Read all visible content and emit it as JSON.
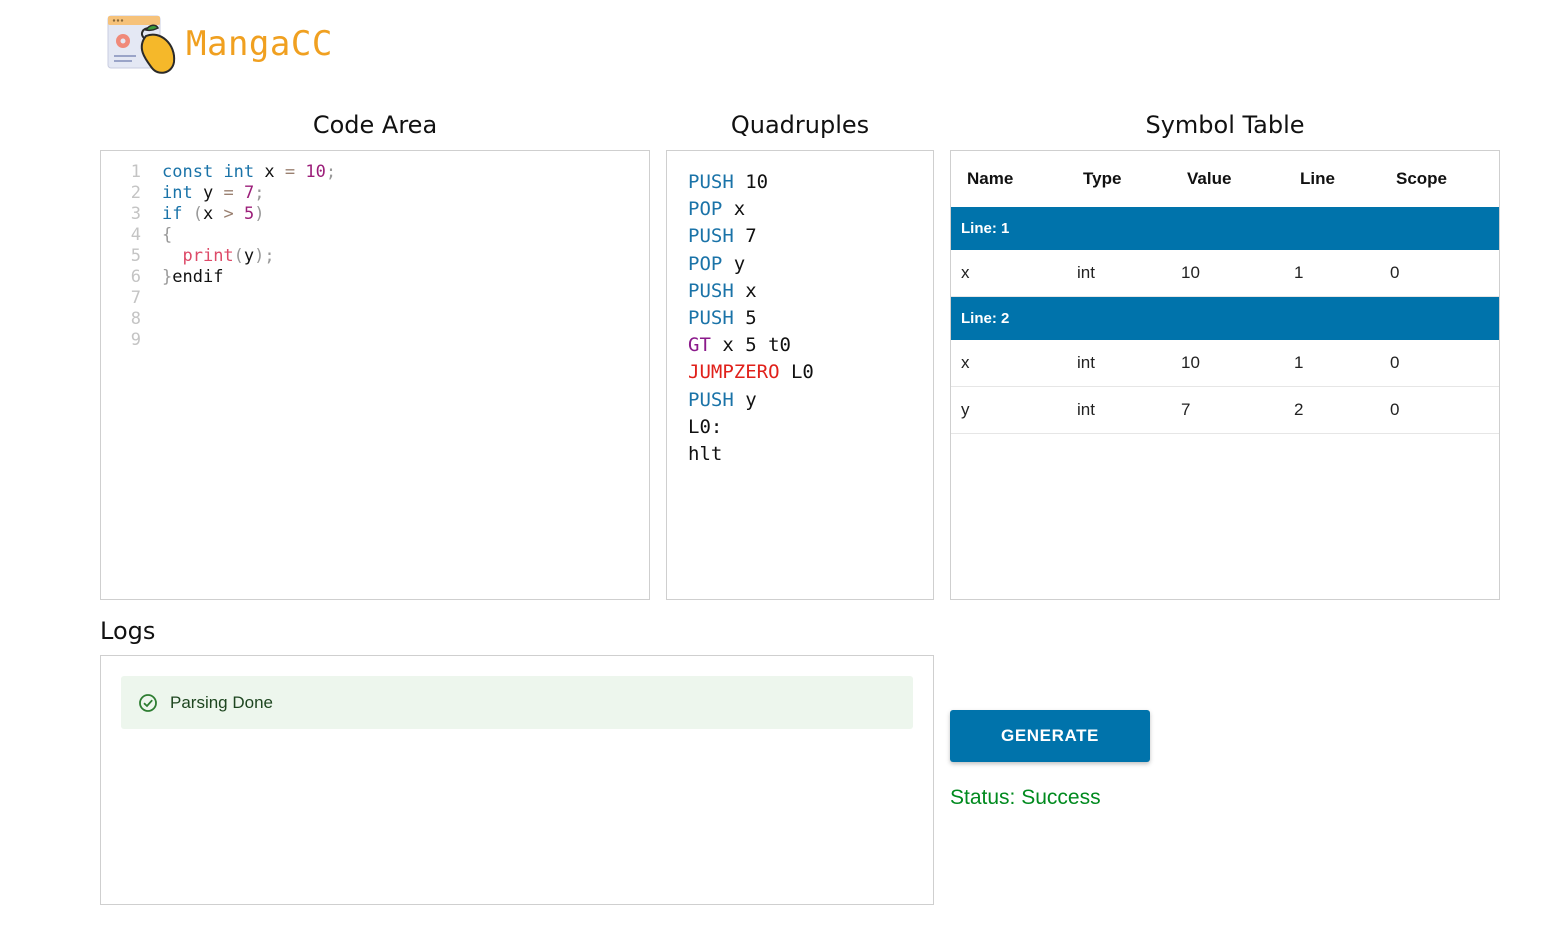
{
  "header": {
    "brand": "MangaCC",
    "logo_icon": "mango-window-icon"
  },
  "titles": {
    "code_area": "Code Area",
    "quadruples": "Quadruples",
    "symbol_table": "Symbol Table",
    "logs": "Logs"
  },
  "code": {
    "line_numbers": [
      "1",
      "2",
      "3",
      "4",
      "5",
      "6",
      "7",
      "8",
      "9"
    ],
    "lines": [
      [
        {
          "t": "const",
          "c": "kw"
        },
        {
          "t": " ",
          "c": "txt"
        },
        {
          "t": "int",
          "c": "kw"
        },
        {
          "t": " x ",
          "c": "txt"
        },
        {
          "t": "=",
          "c": "op"
        },
        {
          "t": " ",
          "c": "txt"
        },
        {
          "t": "10",
          "c": "num"
        },
        {
          "t": ";",
          "c": "punc"
        }
      ],
      [
        {
          "t": "int",
          "c": "kw"
        },
        {
          "t": " y ",
          "c": "txt"
        },
        {
          "t": "=",
          "c": "op"
        },
        {
          "t": " ",
          "c": "txt"
        },
        {
          "t": "7",
          "c": "num"
        },
        {
          "t": ";",
          "c": "punc"
        }
      ],
      [
        {
          "t": "if",
          "c": "kw"
        },
        {
          "t": " ",
          "c": "txt"
        },
        {
          "t": "(",
          "c": "punc"
        },
        {
          "t": "x ",
          "c": "txt"
        },
        {
          "t": ">",
          "c": "op"
        },
        {
          "t": " ",
          "c": "txt"
        },
        {
          "t": "5",
          "c": "num"
        },
        {
          "t": ")",
          "c": "punc"
        }
      ],
      [
        {
          "t": "{",
          "c": "punc"
        }
      ],
      [
        {
          "t": "  ",
          "c": "txt"
        },
        {
          "t": "print",
          "c": "fn"
        },
        {
          "t": "(",
          "c": "punc"
        },
        {
          "t": "y",
          "c": "txt"
        },
        {
          "t": ")",
          "c": "punc"
        },
        {
          "t": ";",
          "c": "punc"
        }
      ],
      [
        {
          "t": "}",
          "c": "punc"
        },
        {
          "t": "endif",
          "c": "txt"
        }
      ],
      [],
      [],
      []
    ]
  },
  "quadruples": [
    {
      "op": "PUSH",
      "cls": "q-push",
      "args": "10"
    },
    {
      "op": "POP",
      "cls": "q-pop",
      "args": "x"
    },
    {
      "op": "PUSH",
      "cls": "q-push",
      "args": "7"
    },
    {
      "op": "POP",
      "cls": "q-pop",
      "args": "y"
    },
    {
      "op": "PUSH",
      "cls": "q-push",
      "args": "x"
    },
    {
      "op": "PUSH",
      "cls": "q-push",
      "args": "5"
    },
    {
      "op": "GT",
      "cls": "q-gt",
      "args": "x 5 t0"
    },
    {
      "op": "JUMPZERO",
      "cls": "q-jz",
      "args": "L0"
    },
    {
      "op": "PUSH",
      "cls": "q-push",
      "args": "y"
    },
    {
      "op": "",
      "cls": "q-arg",
      "args": "L0:"
    },
    {
      "op": "",
      "cls": "q-arg",
      "args": "hlt"
    }
  ],
  "symbol_table": {
    "headers": [
      "Name",
      "Type",
      "Value",
      "Line",
      "Scope"
    ],
    "groups": [
      {
        "label": "Line: 1",
        "rows": [
          [
            "x",
            "int",
            "10",
            "1",
            "0"
          ]
        ]
      },
      {
        "label": "Line: 2",
        "rows": [
          [
            "x",
            "int",
            "10",
            "1",
            "0"
          ],
          [
            "y",
            "int",
            "7",
            "2",
            "0"
          ]
        ]
      }
    ]
  },
  "logs": {
    "entries": [
      {
        "text": "Parsing Done",
        "icon": "check-circle-icon"
      }
    ]
  },
  "actions": {
    "generate_label": "GENERATE"
  },
  "status": {
    "text": "Status: Success",
    "color": "#008a1e"
  },
  "colors": {
    "accent": "#0073ab",
    "brand": "#f0a020"
  }
}
